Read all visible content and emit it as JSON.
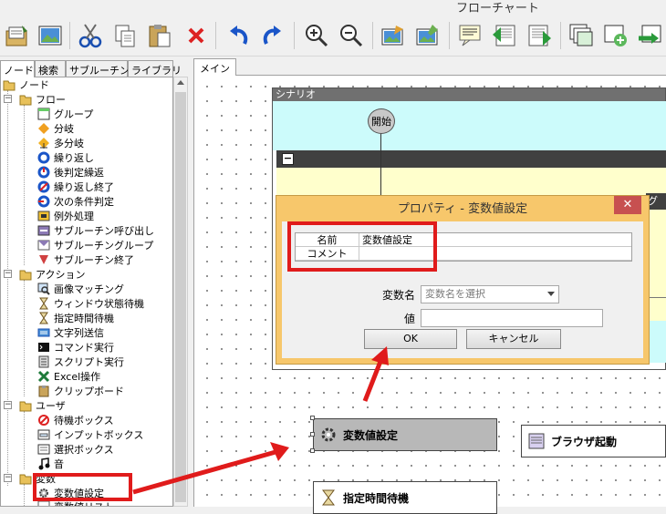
{
  "window": {
    "title": "フローチャート"
  },
  "toolbar": {
    "buttons": [
      {
        "name": "open-icon"
      },
      {
        "name": "image-icon"
      },
      {
        "name": "cut-icon"
      },
      {
        "name": "copy-icon"
      },
      {
        "name": "paste-icon"
      },
      {
        "name": "delete-icon"
      },
      {
        "name": "undo-icon"
      },
      {
        "name": "redo-icon"
      },
      {
        "name": "zoom-in-icon"
      },
      {
        "name": "zoom-out-icon"
      },
      {
        "name": "edit-image-icon"
      },
      {
        "name": "edit-image2-icon"
      },
      {
        "name": "comment-icon"
      },
      {
        "name": "step-in-icon"
      },
      {
        "name": "step-out-icon"
      },
      {
        "name": "stack-icon"
      },
      {
        "name": "add-icon"
      },
      {
        "name": "move-icon"
      }
    ]
  },
  "left_tabs": [
    "ノード",
    "検索",
    "サブルーチン",
    "ライブラリ"
  ],
  "tree": {
    "root": "ノード",
    "groups": [
      {
        "label": "フロー",
        "items": [
          "グループ",
          "分岐",
          "多分岐",
          "繰り返し",
          "後判定繰返",
          "繰り返し終了",
          "次の条件判定",
          "例外処理",
          "サブルーチン呼び出し",
          "サブルーチングループ",
          "サブルーチン終了"
        ]
      },
      {
        "label": "アクション",
        "items": [
          "画像マッチング",
          "ウィンドウ状態待機",
          "指定時間待機",
          "文字列送信",
          "コマンド実行",
          "スクリプト実行",
          "Excel操作",
          "クリップボード"
        ]
      },
      {
        "label": "ユーザ",
        "items": [
          "待機ボックス",
          "インプットボックス",
          "選択ボックス",
          "音"
        ]
      },
      {
        "label": "変数",
        "items": [
          "変数値設定",
          "変数値リスト"
        ]
      }
    ]
  },
  "canvas": {
    "tab": "メイン",
    "scenario_title": "シナリオ",
    "start_label": "開始",
    "group_label": "グル",
    "nodes": {
      "var_set": "変数値設定",
      "browser": "ブラウザ起動",
      "wait": "指定時間待機"
    }
  },
  "dialog": {
    "title": "プロパティ - 変数値設定",
    "close": "✕",
    "grid": {
      "col1": "名前",
      "col2": "変数値設定",
      "row2_col1": "コメント",
      "row2_col2": ""
    },
    "var_label": "変数名",
    "var_placeholder": "変数名を選択",
    "value_label": "値",
    "value": "",
    "ok": "OK",
    "cancel": "キャンセル"
  },
  "colors": {
    "highlight": "#e01b1b",
    "dialog": "#f7c76b",
    "scenario_cyan": "#ccfbfb",
    "scenario_yellow": "#ffffcc"
  }
}
